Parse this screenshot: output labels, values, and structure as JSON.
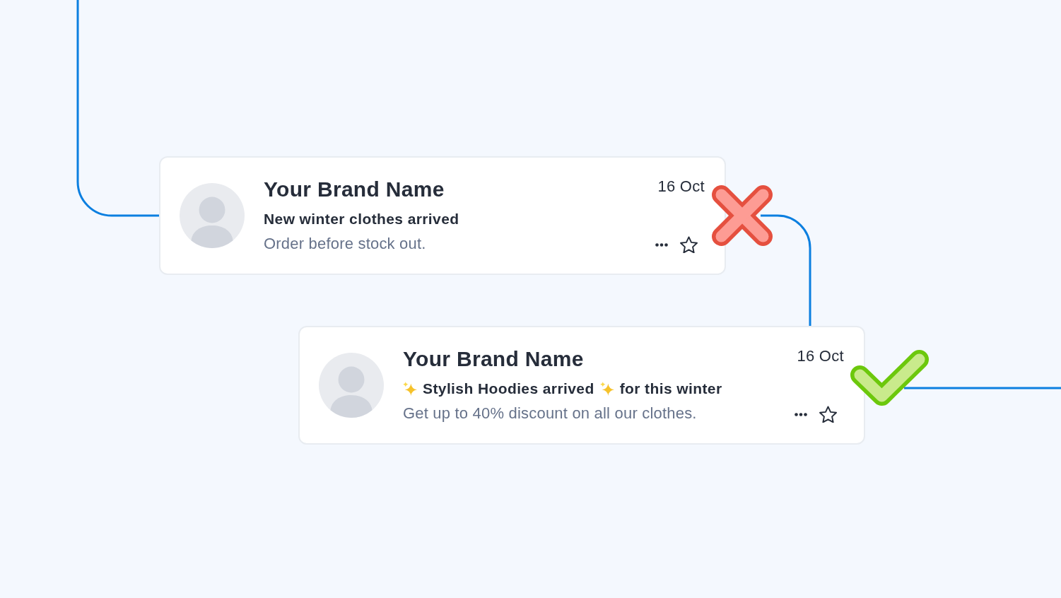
{
  "cards": [
    {
      "kind": "bad",
      "sender": "Your Brand Name",
      "subject": [
        {
          "kind": "text",
          "text": "New winter clothes arrived"
        }
      ],
      "preview": "Order before stock out.",
      "date": "16 Oct",
      "starred": false
    },
    {
      "kind": "good",
      "sender": "Your Brand Name",
      "subject": [
        {
          "kind": "icon"
        },
        {
          "kind": "text",
          "text": "Stylish Hoodies arrived"
        },
        {
          "kind": "icon"
        },
        {
          "kind": "text",
          "text": "for this winter"
        }
      ],
      "preview": "Get up to 40% discount on all our clothes.",
      "date": "16 Oct",
      "starred": false
    }
  ]
}
